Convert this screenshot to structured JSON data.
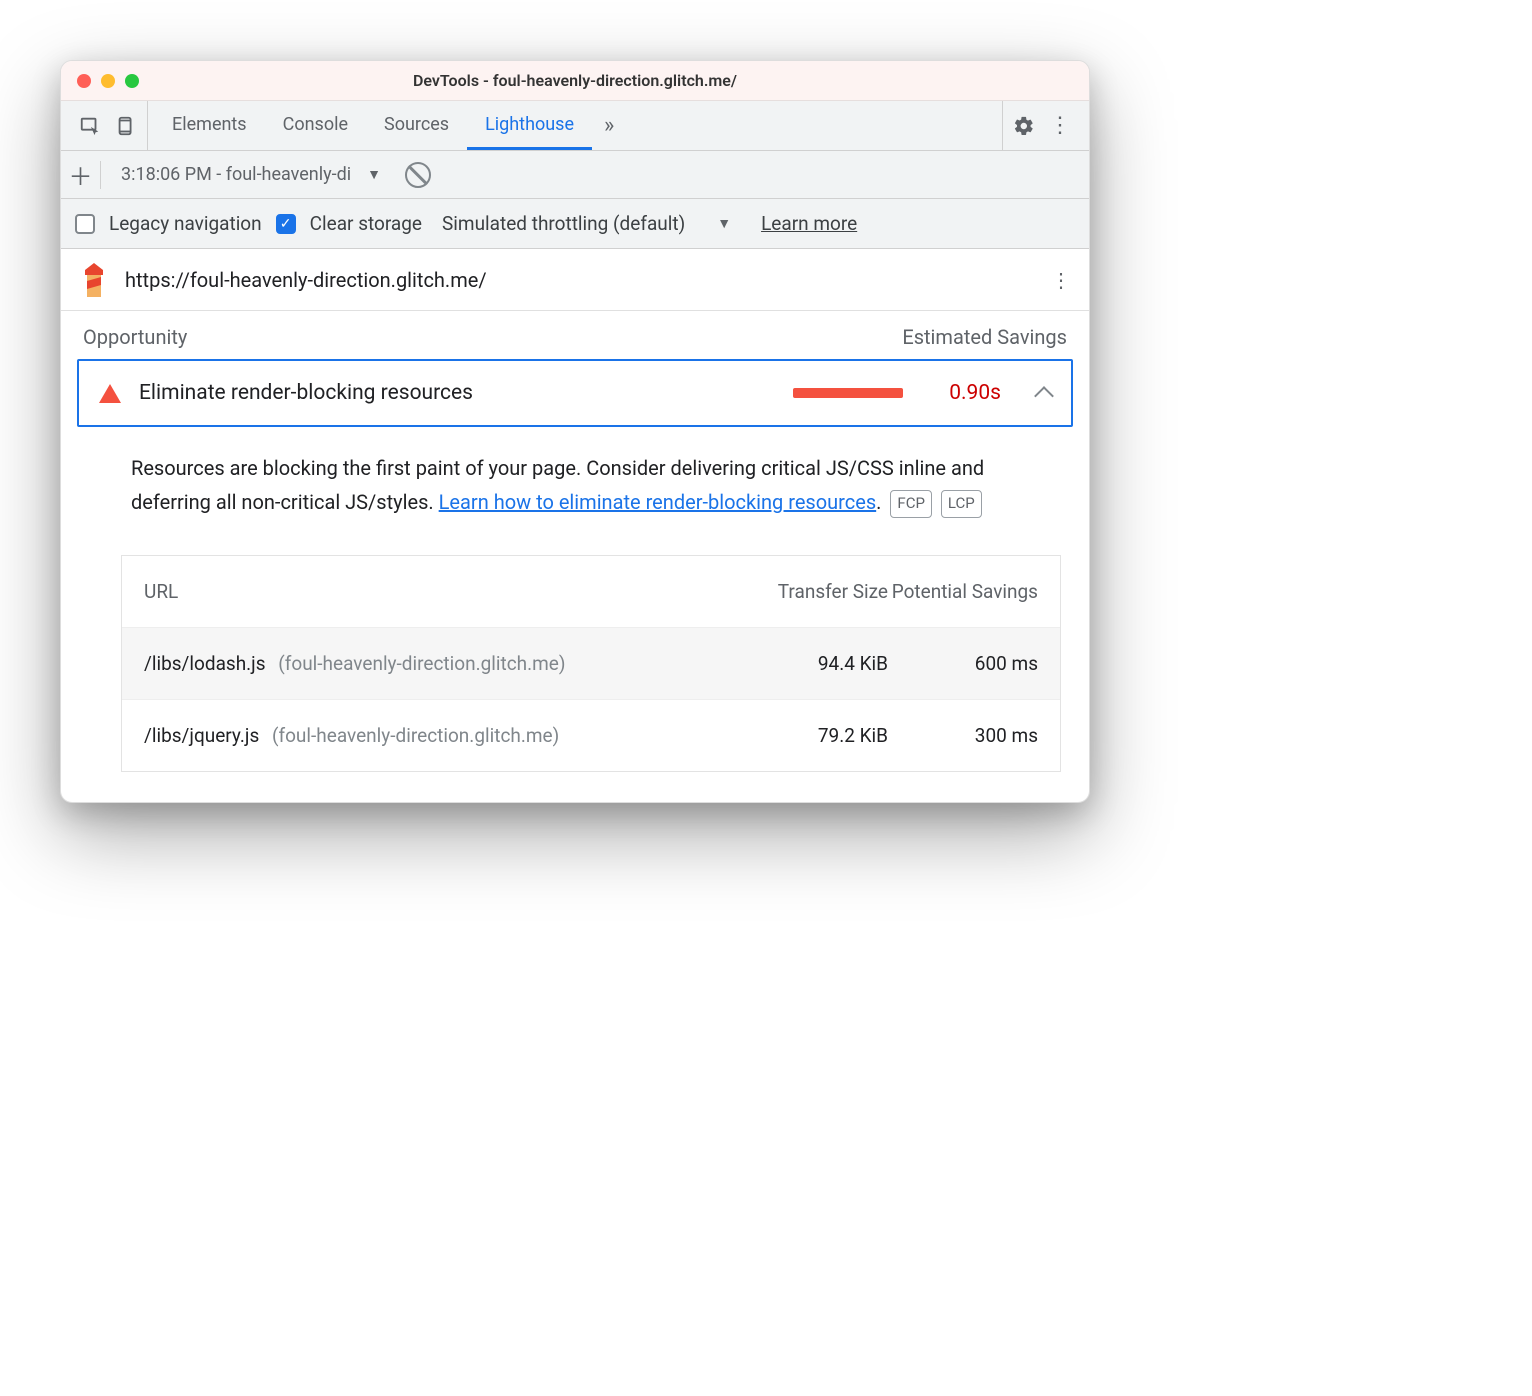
{
  "window": {
    "title": "DevTools - foul-heavenly-direction.glitch.me/"
  },
  "tabs": {
    "items": [
      "Elements",
      "Console",
      "Sources",
      "Lighthouse"
    ],
    "active": "Lighthouse"
  },
  "subbar": {
    "report_selected": "3:18:06 PM - foul-heavenly-di"
  },
  "options": {
    "legacy_label": "Legacy navigation",
    "legacy_checked": false,
    "clear_label": "Clear storage",
    "clear_checked": true,
    "throttling_label": "Simulated throttling (default)",
    "learn_more": "Learn more"
  },
  "report": {
    "url": "https://foul-heavenly-direction.glitch.me/"
  },
  "headers": {
    "opportunity": "Opportunity",
    "savings": "Estimated Savings"
  },
  "audit": {
    "title": "Eliminate render-blocking resources",
    "value": "0.90s",
    "description_pre": "Resources are blocking the first paint of your page. Consider delivering critical JS/CSS inline and deferring all non-critical JS/styles. ",
    "description_link": "Learn how to eliminate render-blocking resources",
    "description_post": ".",
    "tags": [
      "FCP",
      "LCP"
    ]
  },
  "table": {
    "cols": {
      "url": "URL",
      "size": "Transfer Size",
      "savings": "Potential Savings"
    },
    "rows": [
      {
        "path": "/libs/lodash.js",
        "host": "(foul-heavenly-direction.glitch.me)",
        "size": "94.4 KiB",
        "savings": "600 ms"
      },
      {
        "path": "/libs/jquery.js",
        "host": "(foul-heavenly-direction.glitch.me)",
        "size": "79.2 KiB",
        "savings": "300 ms"
      }
    ]
  }
}
